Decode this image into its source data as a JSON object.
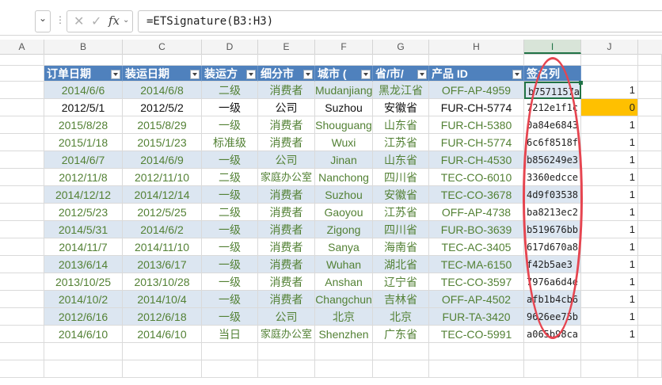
{
  "formula_bar": {
    "namebox_arrow": "⌄",
    "formula": "=ETSignature(B3:H3)"
  },
  "columns": [
    "A",
    "B",
    "C",
    "D",
    "E",
    "F",
    "G",
    "H",
    "I",
    "J"
  ],
  "selected_column": "I",
  "table": {
    "headers": [
      "订单日期",
      "装运日期",
      "装运方",
      "细分市",
      "城市 (",
      "省/市/",
      "产品 ID",
      "签名列"
    ],
    "rows": [
      {
        "b": "2014/6/6",
        "c": "2014/6/8",
        "d": "二级",
        "e": "消费者",
        "f": "Mudanjiang",
        "g": "黑龙江省",
        "h": "OFF-AP-4959",
        "i": "b7571157a",
        "j": "1"
      },
      {
        "b": "2012/5/1",
        "c": "2012/5/2",
        "d": "一级",
        "e": "公司",
        "f": "Suzhou",
        "g": "安徽省",
        "h": "FUR-CH-5774",
        "i": "7212e1f1c",
        "j": "0"
      },
      {
        "b": "2015/8/28",
        "c": "2015/8/29",
        "d": "一级",
        "e": "消费者",
        "f": "Shouguang",
        "g": "山东省",
        "h": "FUR-CH-5380",
        "i": "0a84e6843",
        "j": "1"
      },
      {
        "b": "2015/1/18",
        "c": "2015/1/23",
        "d": "标准级",
        "e": "消费者",
        "f": "Wuxi",
        "g": "江苏省",
        "h": "FUR-CH-5774",
        "i": "6c6f8518f",
        "j": "1"
      },
      {
        "b": "2014/6/7",
        "c": "2014/6/9",
        "d": "一级",
        "e": "公司",
        "f": "Jinan",
        "g": "山东省",
        "h": "FUR-CH-4530",
        "i": "b856249e3",
        "j": "1"
      },
      {
        "b": "2012/11/8",
        "c": "2012/11/10",
        "d": "二级",
        "e": "家庭办公室",
        "f": "Nanchong",
        "g": "四川省",
        "h": "TEC-CO-6010",
        "i": "3360edcce",
        "j": "1"
      },
      {
        "b": "2014/12/12",
        "c": "2014/12/14",
        "d": "一级",
        "e": "消费者",
        "f": "Suzhou",
        "g": "安徽省",
        "h": "TEC-CO-3678",
        "i": "4d9f03538",
        "j": "1"
      },
      {
        "b": "2012/5/23",
        "c": "2012/5/25",
        "d": "二级",
        "e": "消费者",
        "f": "Gaoyou",
        "g": "江苏省",
        "h": "OFF-AP-4738",
        "i": "ba8213ec2",
        "j": "1"
      },
      {
        "b": "2014/5/31",
        "c": "2014/6/2",
        "d": "一级",
        "e": "消费者",
        "f": "Zigong",
        "g": "四川省",
        "h": "FUR-BO-3639",
        "i": "b519676bb",
        "j": "1"
      },
      {
        "b": "2014/11/7",
        "c": "2014/11/10",
        "d": "一级",
        "e": "消费者",
        "f": "Sanya",
        "g": "海南省",
        "h": "TEC-AC-3405",
        "i": "617d670a8",
        "j": "1"
      },
      {
        "b": "2013/6/14",
        "c": "2013/6/17",
        "d": "一级",
        "e": "消费者",
        "f": "Wuhan",
        "g": "湖北省",
        "h": "TEC-MA-6150",
        "i": "f42b5ae3",
        "j": "1"
      },
      {
        "b": "2013/10/25",
        "c": "2013/10/28",
        "d": "一级",
        "e": "消费者",
        "f": "Anshan",
        "g": "辽宁省",
        "h": "TEC-CO-3597",
        "i": "7976a6d4e",
        "j": "1"
      },
      {
        "b": "2014/10/2",
        "c": "2014/10/4",
        "d": "一级",
        "e": "消费者",
        "f": "Changchun",
        "g": "吉林省",
        "h": "OFF-AP-4502",
        "i": "afb1b4cb6",
        "j": "1"
      },
      {
        "b": "2012/6/16",
        "c": "2012/6/18",
        "d": "一级",
        "e": "公司",
        "f": "北京",
        "g": "北京",
        "h": "FUR-TA-3420",
        "i": "9626ee75b",
        "j": "1"
      },
      {
        "b": "2014/6/10",
        "c": "2014/6/10",
        "d": "当日",
        "e": "家庭办公室",
        "f": "Shenzhen",
        "g": "广东省",
        "h": "TEC-CO-5991",
        "i": "a065b98ca",
        "j": "1"
      }
    ]
  },
  "colors": {
    "header_fill": "#4f81bd",
    "band_fill": "#dce6f1",
    "text_green": "#538135",
    "highlight_fill": "#ffc000",
    "annotation": "#e64550"
  },
  "highlight_cell": "J4"
}
